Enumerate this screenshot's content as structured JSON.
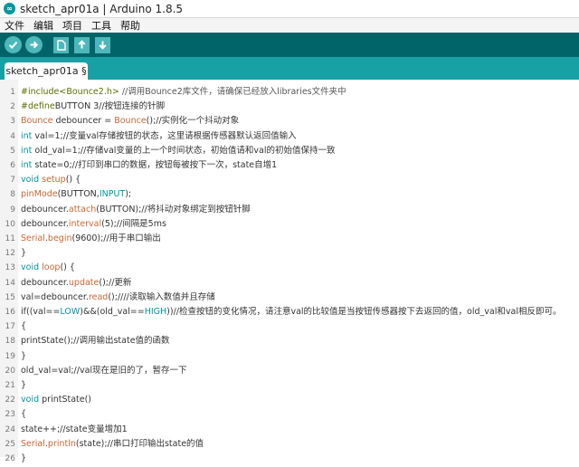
{
  "window": {
    "title": "sketch_apr01a | Arduino 1.8.5",
    "app_icon_glyph": "∞"
  },
  "menu": {
    "items": [
      "文件",
      "编辑",
      "项目",
      "工具",
      "帮助"
    ]
  },
  "toolbar": {
    "buttons": [
      {
        "name": "verify",
        "icon": "checkmark-icon"
      },
      {
        "name": "upload",
        "icon": "arrow-right-icon"
      },
      {
        "name": "new",
        "icon": "new-file-icon"
      },
      {
        "name": "open",
        "icon": "arrow-up-icon"
      },
      {
        "name": "save",
        "icon": "arrow-down-icon"
      }
    ],
    "colors": {
      "bar": "#006468",
      "button": "#4db7bb"
    }
  },
  "tabs": [
    {
      "label": "sketch_apr01a §"
    }
  ],
  "colors": {
    "tab_bar": "#17a1a5",
    "keyword": "#cc6633",
    "type": "#00979c"
  },
  "code": {
    "lines": [
      {
        "n": "1",
        "parts": [
          [
            "pp",
            "#include<Bounce2.h>"
          ],
          [
            "cm",
            " //调用Bounce2库文件，请确保已经放入libraries文件夹中"
          ]
        ]
      },
      {
        "n": "2",
        "parts": [
          [
            "pp",
            "#define"
          ],
          [
            "",
            "BUTTON 3//按钮连接的针脚"
          ]
        ]
      },
      {
        "n": "3",
        "parts": [
          [
            "kw",
            "Bounce"
          ],
          [
            "",
            " debouncer = "
          ],
          [
            "kw",
            "Bounce"
          ],
          [
            "",
            "();//实例化一个抖动对象"
          ]
        ]
      },
      {
        "n": "4",
        "parts": [
          [
            "ty",
            "int"
          ],
          [
            "",
            " val=1;//变量val存储按钮的状态，这里请根据传感器默认返回值输入"
          ]
        ]
      },
      {
        "n": "5",
        "parts": [
          [
            "ty",
            "int"
          ],
          [
            "",
            " old_val=1;//存储val变量的上一个时间状态，初始值请和val的初始值保持一致"
          ]
        ]
      },
      {
        "n": "6",
        "parts": [
          [
            "ty",
            "int"
          ],
          [
            "",
            " state=0;//打印到串口的数据，按钮每被按下一次，state自增1"
          ]
        ]
      },
      {
        "n": "7",
        "parts": [
          [
            "ty",
            "void"
          ],
          [
            "",
            " "
          ],
          [
            "kw",
            "setup"
          ],
          [
            "",
            "() {"
          ]
        ]
      },
      {
        "n": "8",
        "parts": [
          [
            "kw",
            "pinMode"
          ],
          [
            "",
            "(BUTTON,"
          ],
          [
            "ty",
            "INPUT"
          ],
          [
            "",
            ");"
          ]
        ]
      },
      {
        "n": "9",
        "parts": [
          [
            "",
            "debouncer."
          ],
          [
            "kw",
            "attach"
          ],
          [
            "",
            "(BUTTON);//将抖动对象绑定到按钮针脚"
          ]
        ]
      },
      {
        "n": "10",
        "parts": [
          [
            "",
            "debouncer."
          ],
          [
            "kw",
            "interval"
          ],
          [
            "",
            "(5);//间隔是5ms"
          ]
        ]
      },
      {
        "n": "11",
        "parts": [
          [
            "kw",
            "Serial"
          ],
          [
            "",
            "."
          ],
          [
            "kw",
            "begin"
          ],
          [
            "",
            "(9600);//用于串口输出"
          ]
        ]
      },
      {
        "n": "12",
        "parts": [
          [
            "",
            "}"
          ]
        ]
      },
      {
        "n": "13",
        "parts": [
          [
            "ty",
            "void"
          ],
          [
            "",
            " "
          ],
          [
            "kw",
            "loop"
          ],
          [
            "",
            "() {"
          ]
        ]
      },
      {
        "n": "14",
        "parts": [
          [
            "",
            "debouncer."
          ],
          [
            "kw",
            "update"
          ],
          [
            "",
            "();//更新"
          ]
        ]
      },
      {
        "n": "15",
        "parts": [
          [
            "",
            "val=debouncer."
          ],
          [
            "kw",
            "read"
          ],
          [
            "",
            "();////读取输入数值并且存储"
          ]
        ]
      },
      {
        "n": "16",
        "parts": [
          [
            "",
            "if((val=="
          ],
          [
            "ty",
            "LOW"
          ],
          [
            "",
            ")&&(old_val=="
          ],
          [
            "ty",
            "HIGH"
          ],
          [
            "",
            "))//检查按钮的变化情况，请注意val的比较值是当按钮传感器按下去返回的值，old_val和val相反即可。"
          ]
        ]
      },
      {
        "n": "17",
        "parts": [
          [
            "",
            "{"
          ]
        ]
      },
      {
        "n": "18",
        "parts": [
          [
            "",
            "printState();//调用输出state值的函数"
          ]
        ]
      },
      {
        "n": "19",
        "parts": [
          [
            "",
            "}"
          ]
        ]
      },
      {
        "n": "20",
        "parts": [
          [
            "",
            "old_val=val;//val现在是旧的了，暂存一下"
          ]
        ]
      },
      {
        "n": "21",
        "parts": [
          [
            "",
            "}"
          ]
        ]
      },
      {
        "n": "22",
        "parts": [
          [
            "ty",
            "void"
          ],
          [
            "",
            " printState()"
          ]
        ]
      },
      {
        "n": "23",
        "parts": [
          [
            "",
            "{"
          ]
        ]
      },
      {
        "n": "24",
        "parts": [
          [
            "",
            "state++;//state变量增加1"
          ]
        ]
      },
      {
        "n": "25",
        "parts": [
          [
            "kw",
            "Serial"
          ],
          [
            "",
            "."
          ],
          [
            "kw",
            "println"
          ],
          [
            "",
            "(state);//串口打印输出state的值"
          ]
        ]
      },
      {
        "n": "26",
        "parts": [
          [
            "",
            "}"
          ]
        ]
      }
    ]
  }
}
